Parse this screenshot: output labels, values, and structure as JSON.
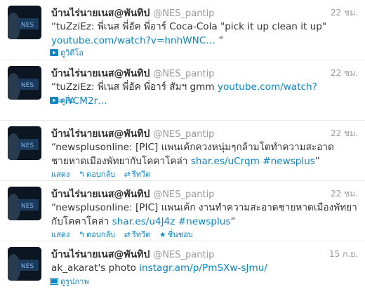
{
  "tweets": [
    {
      "name": "บ้านไร่นายเนส@พันทิป",
      "handle": "@NES_pantip",
      "time": "22 ชม.",
      "text": "“tuZziEz: พี่เนส พี่อัค พี่อาร์ Coca-Cola \"pick it up clean it up\"",
      "link": "youtube.com/watch?v=hnhWNC…",
      "suffix": " ”",
      "media_label": "ดูวิดีโอ",
      "media_icon": "video-icon"
    },
    {
      "name": "บ้านไร่นายเนส@พันทิป",
      "handle": "@NES_pantip",
      "time": "22 ชม.",
      "text": "“tuZziEz: พี่เนส พี่อัค พี่อาร์ สัมฯ gmm ",
      "link": "youtube.com/watch?v=iYCM2r…",
      "media_label": "ดูสื่อ",
      "media_icon": "media-icon"
    },
    {
      "name": "บ้านไร่นายเนส@พันทิป",
      "handle": "@NES_pantip",
      "time": "22 ชม.",
      "text": "“newsplusonline: [PIC] แพนเค้กควงหนุ่มๆกล้ามโตทำความสะอาดชายหาดเมืองพัทยากับโคคาโคล่า ",
      "link": "shar.es/uCrqm",
      "hashtag": "#newsplus",
      "suffix": "”",
      "actions": {
        "show": "แสดง",
        "reply": "ตอบกลับ",
        "retweet": "รีทวีต"
      }
    },
    {
      "name": "บ้านไร่นายเนส@พันทิป",
      "handle": "@NES_pantip",
      "time": "22 ชม.",
      "text": "“newsplusonline: [PIC] แพนเค้ก งานทำความสะอาดชายหาดเมืองพัทยากับโคคาโคล่า ",
      "link": "shar.es/u4J4z",
      "hashtag": "#newsplus",
      "suffix": "”",
      "actions": {
        "show": "แสดง",
        "reply": "ตอบกลับ",
        "retweet": "รีทวีต",
        "favorite": "ชื่นชอบ"
      }
    },
    {
      "name": "บ้านไร่นายเนส@พันทิป",
      "handle": "@NES_pantip",
      "time": "15 ก.ย.",
      "text": "ak_akarat's photo ",
      "link": "instagr.am/p/PmSXw-sJmu/",
      "media_label": "ดูรูปภาพ",
      "media_icon": "photo-icon"
    }
  ],
  "colors": {
    "link": "#0a84c8",
    "meta": "#999999",
    "text": "#333333",
    "avatar_bg": "#0b1622"
  }
}
